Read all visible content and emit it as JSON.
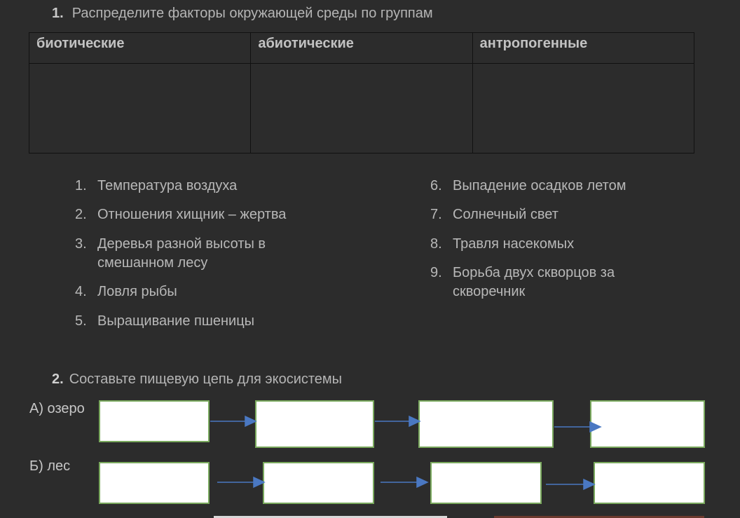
{
  "task1": {
    "number": "1.",
    "title": "Распределите факторы окружающей среды по группам",
    "table": {
      "headers": [
        "биотические",
        "абиотические",
        "антропогенные"
      ],
      "cells": [
        "",
        "",
        ""
      ]
    },
    "items_left": [
      {
        "n": "1.",
        "lines": [
          "Температура воздуха"
        ]
      },
      {
        "n": "2.",
        "lines": [
          "Отношения хищник – жертва"
        ]
      },
      {
        "n": "3.",
        "lines": [
          "Деревья разной высоты в",
          "смешанном лесу"
        ]
      },
      {
        "n": "4.",
        "lines": [
          "Ловля рыбы"
        ]
      },
      {
        "n": "5.",
        "lines": [
          "Выращивание пшеницы"
        ]
      }
    ],
    "items_right": [
      {
        "n": "6.",
        "lines": [
          "Выпадение осадков летом"
        ]
      },
      {
        "n": "7.",
        "lines": [
          "Солнечный свет"
        ]
      },
      {
        "n": "8.",
        "lines": [
          "Травля насекомых"
        ]
      },
      {
        "n": "9.",
        "lines": [
          "Борьба двух скворцов за",
          "скворечник"
        ]
      }
    ]
  },
  "task2": {
    "number": "2.",
    "title": "Составьте пищевую цепь для экосистемы",
    "row_a_label": "А) озеро",
    "row_b_label": "Б) лес"
  },
  "colors": {
    "background": "#2c2c2c",
    "text": "#b8b8b8",
    "box_fill": "#ffffff",
    "box_border": "#79a85d",
    "arrow": "#4a78c2"
  }
}
